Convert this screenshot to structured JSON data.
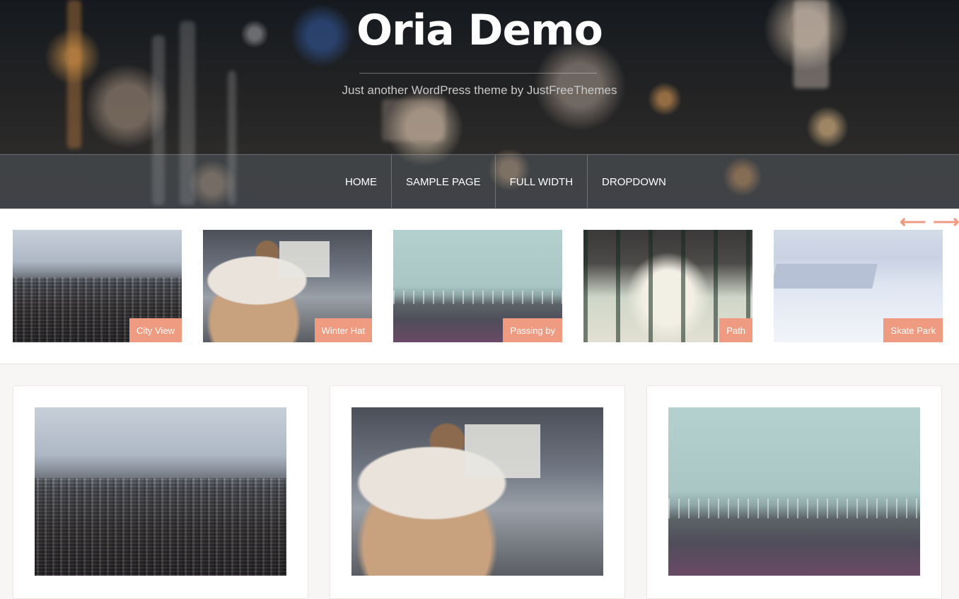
{
  "site": {
    "title": "Oria Demo",
    "tagline": "Just another WordPress theme by JustFreeThemes"
  },
  "nav": {
    "items": [
      {
        "label": "HOME"
      },
      {
        "label": "SAMPLE PAGE"
      },
      {
        "label": "FULL WIDTH"
      },
      {
        "label": "DROPDOWN"
      }
    ]
  },
  "carousel": {
    "prev_icon": "arrow-left-icon",
    "next_icon": "arrow-right-icon",
    "prev_glyph": "⟵",
    "next_glyph": "⟶",
    "slides": [
      {
        "label": "City View"
      },
      {
        "label": "Winter Hat"
      },
      {
        "label": "Passing by"
      },
      {
        "label": "Path"
      },
      {
        "label": "Skate Park"
      }
    ]
  },
  "colors": {
    "accent": "#ee9b82",
    "background": "#f8f6f5"
  }
}
